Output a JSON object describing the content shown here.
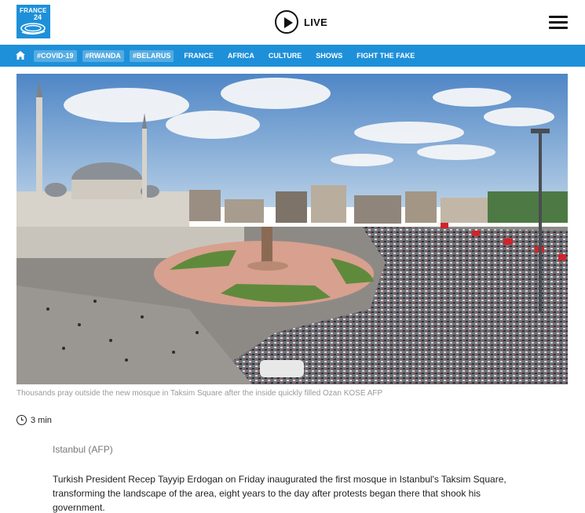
{
  "header": {
    "logo_line1": "FRANCE",
    "logo_line2": "24",
    "live_label": "LIVE"
  },
  "nav": {
    "tags": [
      "#COVID-19",
      "#RWANDA",
      "#BELARUS"
    ],
    "links": [
      "FRANCE",
      "AFRICA",
      "CULTURE",
      "SHOWS",
      "FIGHT THE FAKE"
    ]
  },
  "article": {
    "caption": "Thousands pray outside the new mosque in Taksim Square after the inside quickly filled  Ozan KOSE AFP",
    "read_time": "3 min",
    "dateline": "Istanbul (AFP)",
    "lead": "Turkish President Recep Tayyip Erdogan on Friday inaugurated the first mosque in Istanbul's Taksim Square, transforming the landscape of the area, eight years to the day after protests began there that shook his government."
  },
  "colors": {
    "brand_blue": "#1e90d9"
  }
}
